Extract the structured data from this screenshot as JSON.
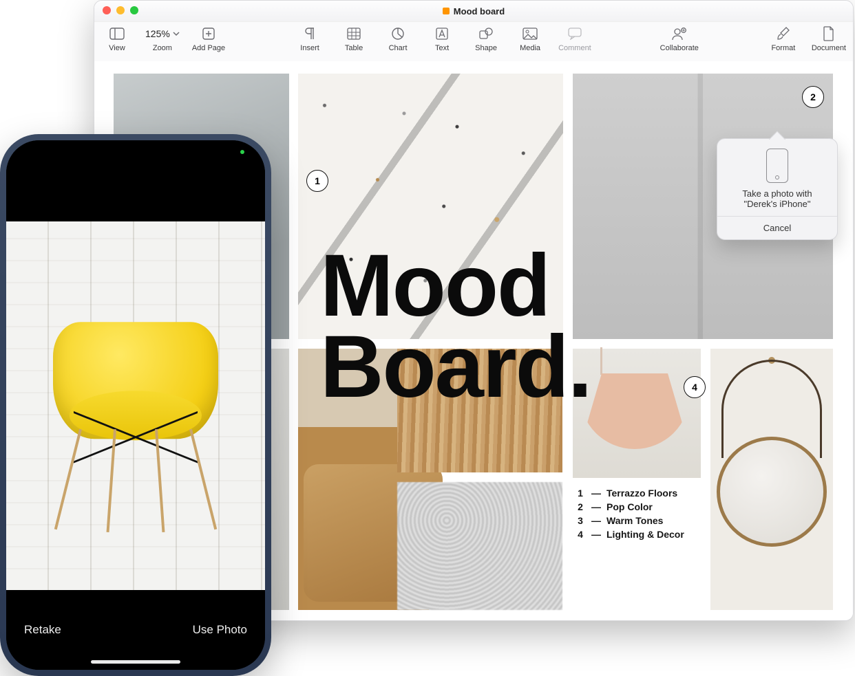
{
  "window": {
    "title": "Mood board"
  },
  "toolbar": {
    "view": "View",
    "zoom_label": "Zoom",
    "zoom_value": "125%",
    "add_page": "Add Page",
    "insert": "Insert",
    "table": "Table",
    "chart": "Chart",
    "text": "Text",
    "shape": "Shape",
    "media": "Media",
    "comment": "Comment",
    "collaborate": "Collaborate",
    "format": "Format",
    "document": "Document"
  },
  "document": {
    "headline_l1": "Mood",
    "headline_l2": "Board.",
    "callouts": {
      "c1": "1",
      "c2": "2",
      "c4": "4"
    },
    "legend": [
      {
        "n": "1",
        "label": "Terrazzo Floors"
      },
      {
        "n": "2",
        "label": "Pop Color"
      },
      {
        "n": "3",
        "label": "Warm Tones"
      },
      {
        "n": "4",
        "label": "Lighting & Decor"
      }
    ]
  },
  "popover": {
    "line1": "Take a photo with",
    "line2": "\"Derek's iPhone\"",
    "cancel": "Cancel"
  },
  "iphone": {
    "retake": "Retake",
    "use_photo": "Use Photo"
  }
}
